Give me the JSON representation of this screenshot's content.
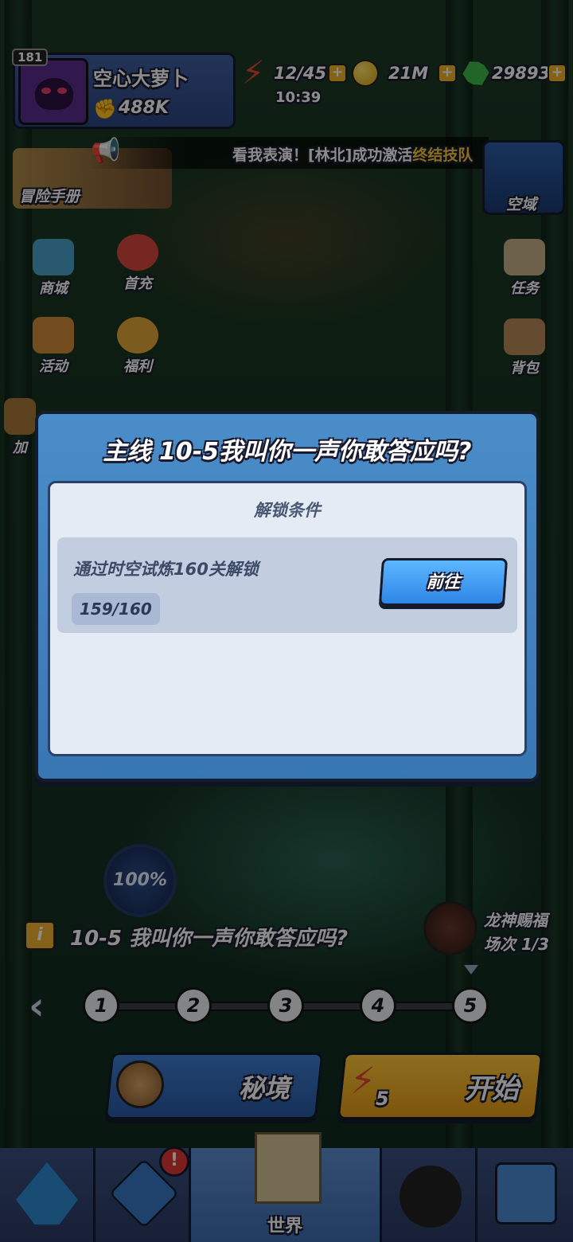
{
  "player": {
    "level": "181",
    "name": "空心大萝卜",
    "power": "488K"
  },
  "resources": {
    "energy": "12/45",
    "energy_timer": "10:39",
    "coins": "21M",
    "gems": "29893",
    "plus": "+"
  },
  "ticker": {
    "prefix": "看我表演！[林北]成功激活",
    "highlight": "终结技队"
  },
  "top_buttons": {
    "adventure": "冒险手册",
    "domain": "空域"
  },
  "side_menu": {
    "shop": "商城",
    "first_charge": "首充",
    "activity": "活动",
    "welfare": "福利",
    "tasks": "任务",
    "bag": "背包",
    "partial": "加"
  },
  "modal": {
    "title": "主线 10-5我叫你一声你敢答应吗?",
    "heading": "解锁条件",
    "condition": "通过时空试炼160关解锁",
    "progress": "159/160",
    "progress_value": 0.99375,
    "go_button": "前往"
  },
  "stage": {
    "completion": "100%",
    "info_icon": "i",
    "name": "10-5 我叫你一声你敢答应吗?",
    "dragon_title": "龙神赐福",
    "dragon_count": "场次 1/3",
    "nodes": [
      "1",
      "2",
      "3",
      "4",
      "5"
    ],
    "current_node": "5"
  },
  "actions": {
    "secret_realm": "秘境",
    "start": "开始",
    "start_cost": "5"
  },
  "bottom_nav": {
    "world": "世界",
    "badge": "!"
  },
  "colors": {
    "modal_blue": "#3877b4",
    "go_button": "#2e86e6",
    "start_button": "#e59a16",
    "ticker_highlight": "#f8c83a"
  }
}
